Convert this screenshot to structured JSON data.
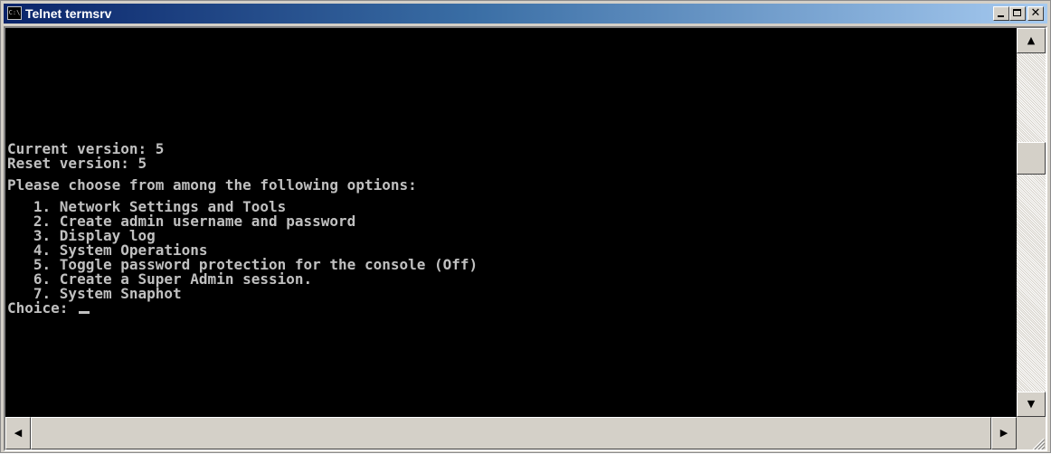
{
  "window": {
    "title": "Telnet termsrv",
    "icon": "console-icon",
    "icon_text": "C:\\",
    "buttons": {
      "minimize": "minimize-icon",
      "maximize": "maximize-icon",
      "close_glyph": "✕"
    }
  },
  "console": {
    "colors": {
      "background": "#000000",
      "foreground": "#c0c0c0"
    },
    "lines": [
      "Current version: 5",
      "Reset version: 5",
      "",
      "Please choose from among the following options:",
      "",
      "   1. Network Settings and Tools",
      "   2. Create admin username and password",
      "   3. Display log",
      "   4. System Operations",
      "   5. Toggle password protection for the console (Off)",
      "   6. Create a Super Admin session.",
      "   7. System Snaphot"
    ],
    "prompt": "Choice: "
  },
  "scrollbars": {
    "up_glyph": "▲",
    "down_glyph": "▼",
    "left_glyph": "◀",
    "right_glyph": "▶"
  }
}
